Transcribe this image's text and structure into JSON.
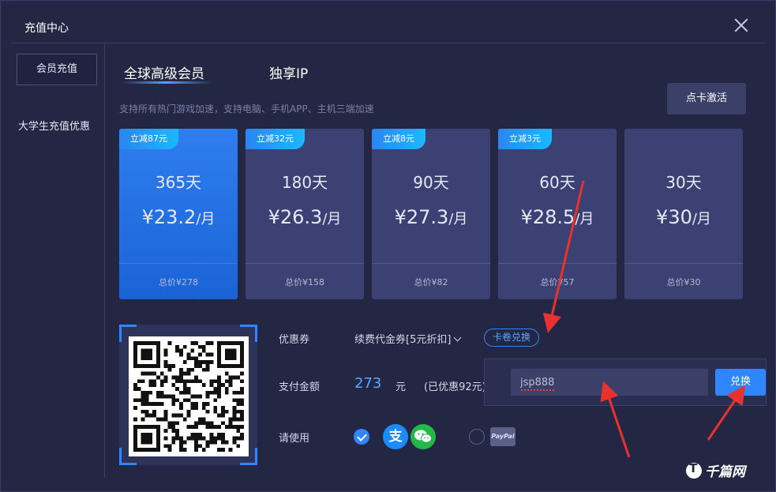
{
  "window": {
    "title": "充值中心"
  },
  "sidebar": {
    "items": [
      {
        "label": "会员充值"
      },
      {
        "label": "大学生充值优惠"
      }
    ]
  },
  "tabs": [
    {
      "label": "全球高级会员"
    },
    {
      "label": "独享IP"
    }
  ],
  "subtitle": "支持所有热门游戏加速，支持电脑、手机APP、主机三端加速",
  "activate_button": "点卡激活",
  "plans": [
    {
      "tag": "立减87元",
      "days": "365天",
      "price": "¥23.2",
      "unit": "/月",
      "total": "总价¥278"
    },
    {
      "tag": "立减32元",
      "days": "180天",
      "price": "¥26.3",
      "unit": "/月",
      "total": "总价¥158"
    },
    {
      "tag": "立减8元",
      "days": "90天",
      "price": "¥27.3",
      "unit": "/月",
      "total": "总价¥82"
    },
    {
      "tag": "立减3元",
      "days": "60天",
      "price": "¥28.5",
      "unit": "/月",
      "total": "总价¥57"
    },
    {
      "tag": "",
      "days": "30天",
      "price": "¥30",
      "unit": "/月",
      "total": "总价¥30"
    }
  ],
  "payment": {
    "coupon_label": "优惠券",
    "coupon_value": "续费代金券[5元折扣]",
    "redeem_link": "卡卷兑换",
    "amount_label": "支付金额",
    "amount": "273",
    "amount_unit": "元",
    "saved": "(已优惠92元)",
    "use_label": "请使用"
  },
  "redeem": {
    "code": "jsp888",
    "button": "兑换"
  },
  "methods": {
    "alipay_glyph": "支",
    "paypal_label": "PayPal"
  },
  "watermark": "千篇网",
  "colors": {
    "accent": "#2f86ff",
    "annotation": "#e8322f",
    "bg": "#232744"
  }
}
